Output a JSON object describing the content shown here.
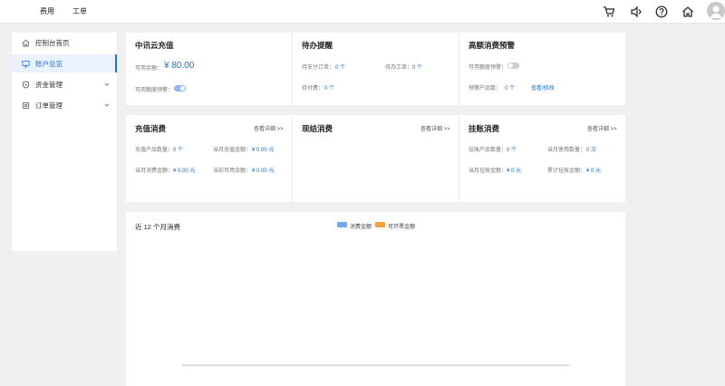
{
  "topbar": {
    "nav": [
      "费用",
      "工单"
    ],
    "icons": [
      "cart-icon",
      "speaker-icon",
      "help-icon",
      "home-icon",
      "user-avatar-icon"
    ]
  },
  "sidebar": {
    "items": [
      {
        "label": "控制台首页",
        "icon": "home-icon"
      },
      {
        "label": "账户总览",
        "icon": "monitor-icon",
        "active": true
      },
      {
        "label": "资金管理",
        "icon": "shield-icon",
        "expandable": true
      },
      {
        "label": "订单管理",
        "icon": "gear-icon",
        "expandable": true
      }
    ]
  },
  "recharge": {
    "title": "中讯云充值",
    "balance_label": "可用余额：",
    "balance_value": "¥ 80.00",
    "alert_label": "可用额度预警："
  },
  "todo": {
    "title": "待办提醒",
    "pending_pay_label": "待支付订单：",
    "pending_pay_value": "0 个",
    "pending_ticket_label": "待办工单：",
    "pending_ticket_value": "0 个",
    "pending_fee_label": "待付费：",
    "pending_fee_value": "0 个"
  },
  "high_alert": {
    "title": "高额消费预警",
    "alert_label": "可用额度预警：",
    "count_label": "预警产品数：",
    "count_value": "0 个",
    "link": "查看/修改"
  },
  "prepaid": {
    "title": "充值消费",
    "link": "查看详细 >>",
    "product_count_label": "充值产品数量：",
    "product_count_value": "0 个",
    "month_recharge_label": "当月充值金额：",
    "month_recharge_value": "¥ 0.00 元",
    "month_spend_label": "当月消费金额：",
    "month_spend_value": "¥ 0.00 元",
    "current_balance_label": "当前可用余额：",
    "current_balance_value": "¥ 0.00 元"
  },
  "settle": {
    "title": "现结消费",
    "link": "查看详细 >>"
  },
  "credit": {
    "title": "挂账消费",
    "link": "查看详细 >>",
    "product_count_label": "挂账产品数量：",
    "product_count_value": "0 个",
    "month_use_label": "当月使用数量：",
    "month_use_value": "0 次",
    "month_amount_label": "当月挂账金额：",
    "month_amount_value": "¥ 0 元",
    "total_amount_label": "累计挂账金额：",
    "total_amount_value": "¥ 0 元"
  },
  "chart_data": {
    "type": "bar",
    "title": "近 12 个月消费",
    "categories": [],
    "series": [
      {
        "name": "消费金额",
        "color": "#6fa8f0",
        "values": []
      },
      {
        "name": "可开票金额",
        "color": "#f5a040",
        "values": []
      }
    ]
  }
}
